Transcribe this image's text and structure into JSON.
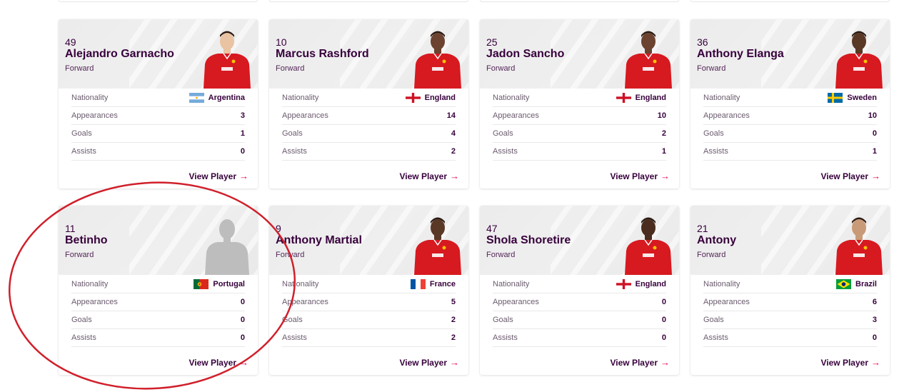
{
  "labels": {
    "nationality": "Nationality",
    "appearances": "Appearances",
    "goals": "Goals",
    "assists": "Assists",
    "view_player": "View Player",
    "arrow": "→"
  },
  "players": [
    {
      "number": "49",
      "name": "Alejandro Garnacho",
      "position": "Forward",
      "nationality": "Argentina",
      "flag": "argentina-flag",
      "appearances": "3",
      "goals": "1",
      "assists": "0",
      "photo": "player-photo"
    },
    {
      "number": "10",
      "name": "Marcus Rashford",
      "position": "Forward",
      "nationality": "England",
      "flag": "england-flag",
      "appearances": "14",
      "goals": "4",
      "assists": "2",
      "photo": "player-photo"
    },
    {
      "number": "25",
      "name": "Jadon Sancho",
      "position": "Forward",
      "nationality": "England",
      "flag": "england-flag",
      "appearances": "10",
      "goals": "2",
      "assists": "1",
      "photo": "player-photo"
    },
    {
      "number": "36",
      "name": "Anthony Elanga",
      "position": "Forward",
      "nationality": "Sweden",
      "flag": "sweden-flag",
      "appearances": "10",
      "goals": "0",
      "assists": "1",
      "photo": "player-photo"
    },
    {
      "number": "11",
      "name": "Betinho",
      "position": "Forward",
      "nationality": "Portugal",
      "flag": "portugal-flag",
      "appearances": "0",
      "goals": "0",
      "assists": "0",
      "photo": "silhouette-placeholder"
    },
    {
      "number": "9",
      "name": "Anthony Martial",
      "position": "Forward",
      "nationality": "France",
      "flag": "france-flag",
      "appearances": "5",
      "goals": "2",
      "assists": "2",
      "photo": "player-photo"
    },
    {
      "number": "47",
      "name": "Shola Shoretire",
      "position": "Forward",
      "nationality": "England",
      "flag": "england-flag",
      "appearances": "0",
      "goals": "0",
      "assists": "0",
      "photo": "player-photo"
    },
    {
      "number": "21",
      "name": "Antony",
      "position": "Forward",
      "nationality": "Brazil",
      "flag": "brazil-flag",
      "appearances": "6",
      "goals": "3",
      "assists": "0",
      "photo": "player-photo"
    }
  ],
  "colors": {
    "primary": "#37003c",
    "accent_arrow": "#e90052",
    "annotation_circle": "#d0202b",
    "kit_red": "#d71920"
  }
}
